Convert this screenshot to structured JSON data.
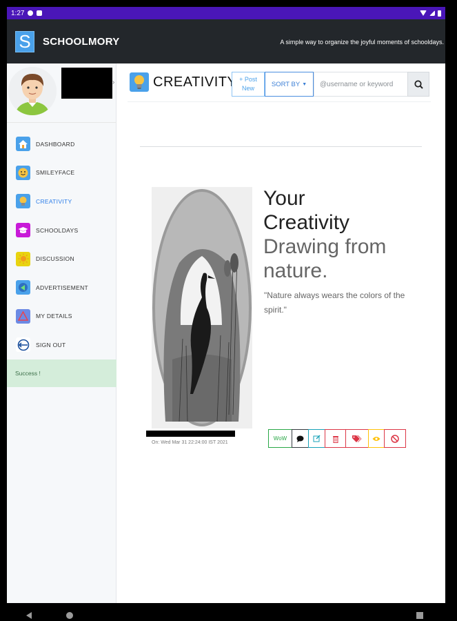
{
  "status_bar": {
    "time": "1:27"
  },
  "app": {
    "logo_letter": "S",
    "title": "SCHOOLMORY",
    "tagline": "A simple way to organize the joyful moments of schooldays."
  },
  "sidebar": {
    "items": [
      {
        "label": "DASHBOARD",
        "icon": "house-icon",
        "color": "#4aa1ea"
      },
      {
        "label": "SMILEYFACE",
        "icon": "smiley-icon",
        "color": "#4aa1ea"
      },
      {
        "label": "CREATIVITY",
        "icon": "lightbulb-icon",
        "color": "#4aa1ea",
        "active": true
      },
      {
        "label": "SCHOOLDAYS",
        "icon": "graduation-cap-icon",
        "color": "#c81ad8"
      },
      {
        "label": "DISCUSSION",
        "icon": "sun-icon",
        "color": "#e8d410"
      },
      {
        "label": "ADVERTISEMENT",
        "icon": "megaphone-icon",
        "color": "#4aa1ea"
      },
      {
        "label": "MY DETAILS",
        "icon": "triangle-icon",
        "color": "#6c8ae4"
      },
      {
        "label": "SIGN OUT",
        "icon": "exit-icon",
        "color": "#ffffff"
      }
    ],
    "success_message": "Success !"
  },
  "main": {
    "title": "CREATIVITY",
    "post_new_label": "+ Post New",
    "sort_label": "SORT BY",
    "search_placeholder": "@username or keyword"
  },
  "post": {
    "title_line1": "Your",
    "title_line2": "Creativity",
    "title_line3": "Drawing from",
    "title_line4": "nature.",
    "quote": "\"Nature always wears the colors of the spirit.\"",
    "date": "On: Wed Mar 31 22:24:00 IST 2021",
    "wow_label": "WoW"
  },
  "colors": {
    "status_bar": "#4a16b8",
    "app_bar": "#23272b",
    "accent": "#4aa1ea",
    "success_bg": "#d4edda"
  }
}
